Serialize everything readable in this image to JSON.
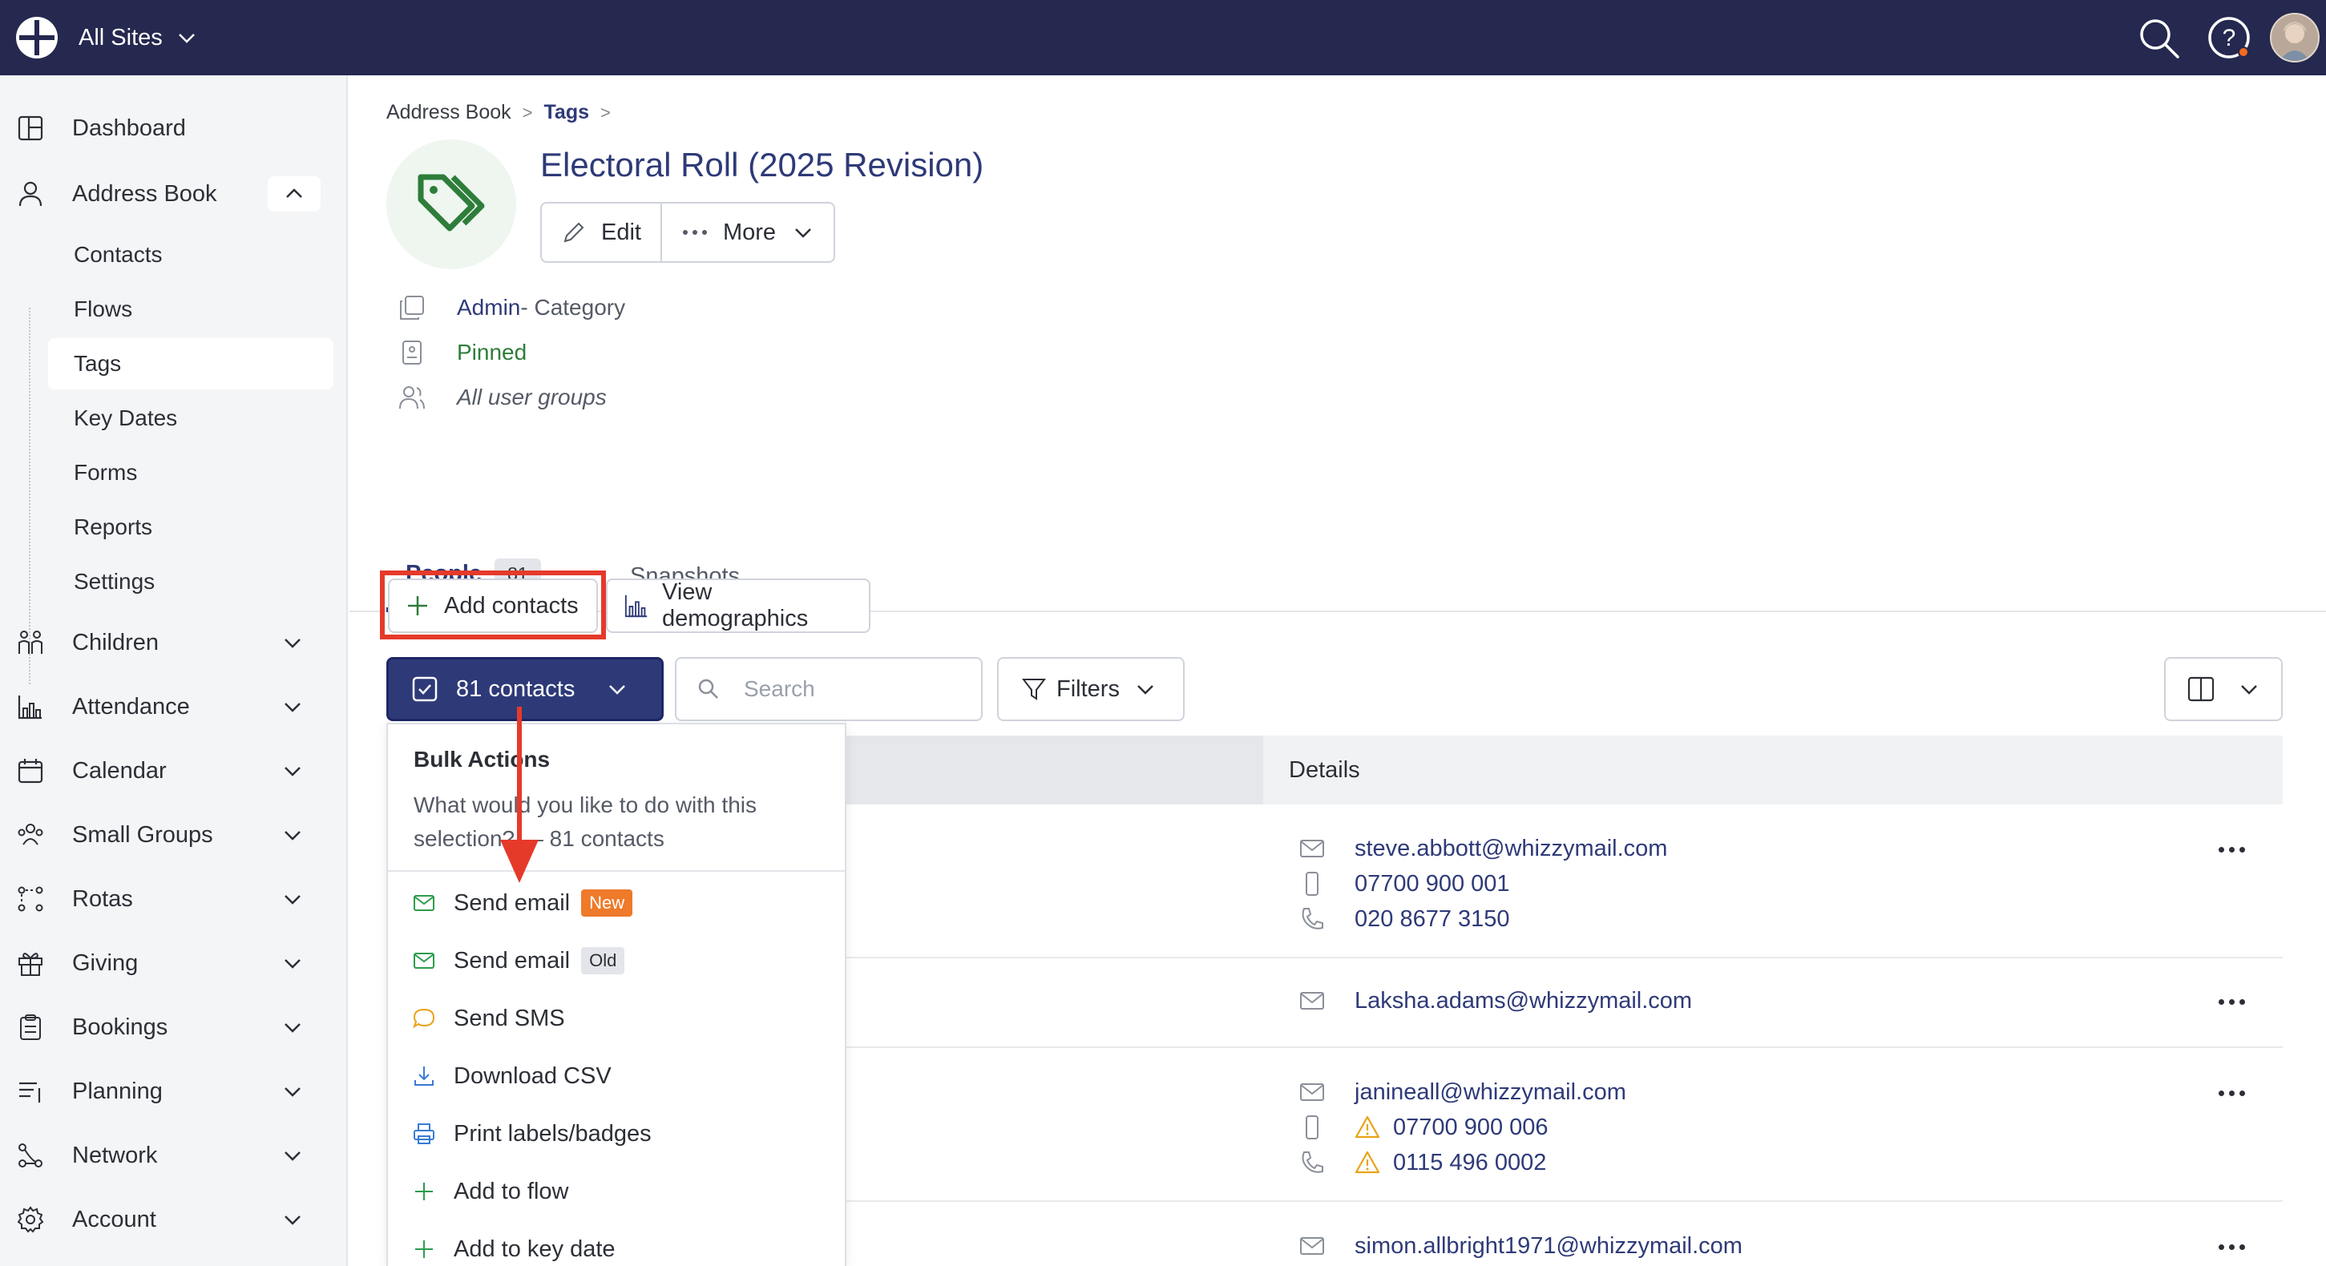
{
  "topbar": {
    "site_label": "All Sites"
  },
  "sidebar": {
    "items": [
      {
        "label": "Dashboard",
        "icon": "dashboard-icon"
      },
      {
        "label": "Address Book",
        "icon": "person-icon"
      },
      {
        "label": "Children",
        "icon": "children-icon"
      },
      {
        "label": "Attendance",
        "icon": "attendance-icon"
      },
      {
        "label": "Calendar",
        "icon": "calendar-icon"
      },
      {
        "label": "Small Groups",
        "icon": "small-groups-icon"
      },
      {
        "label": "Rotas",
        "icon": "rotas-icon"
      },
      {
        "label": "Giving",
        "icon": "gift-icon"
      },
      {
        "label": "Bookings",
        "icon": "bookings-icon"
      },
      {
        "label": "Planning",
        "icon": "planning-icon"
      },
      {
        "label": "Network",
        "icon": "network-icon"
      },
      {
        "label": "Account",
        "icon": "gear-icon"
      }
    ],
    "sub_items": [
      "Contacts",
      "Flows",
      "Tags",
      "Key Dates",
      "Forms",
      "Reports",
      "Settings"
    ],
    "active_sub": "Tags"
  },
  "breadcrumb": {
    "parent": "Address Book",
    "current": "Tags"
  },
  "tag": {
    "title": "Electoral Roll (2025 Revision)",
    "edit_label": "Edit",
    "more_label": "More",
    "category_link": "Admin",
    "category_suffix": " - Category",
    "pinned": "Pinned",
    "groups": "All user groups"
  },
  "tabs": {
    "people_label": "People",
    "people_count": "81",
    "snapshots_label": "Snapshots"
  },
  "toolbar": {
    "add_contacts": "Add contacts",
    "view_demographics": "View demographics",
    "selection_label": "81 contacts",
    "search_placeholder": "Search",
    "filters_label": "Filters"
  },
  "table": {
    "details_header": "Details",
    "rows": [
      {
        "email": "steve.abbott@whizzymail.com",
        "mobile": "07700 900 001",
        "phone": "020 8677 3150"
      },
      {
        "email": "Laksha.adams@whizzymail.com"
      },
      {
        "email": "janineall@whizzymail.com",
        "mobile": "07700 900 006",
        "phone": "0115 496 0002"
      },
      {
        "email": "simon.allbright1971@whizzymail.com"
      }
    ]
  },
  "bulk_actions": {
    "title": "Bulk Actions",
    "description": "What would you like to do with this selection? — 81 contacts",
    "items": [
      {
        "label": "Send email",
        "badge": "New"
      },
      {
        "label": "Send email",
        "badge": "Old"
      },
      {
        "label": "Send SMS"
      },
      {
        "label": "Download CSV"
      },
      {
        "label": "Print labels/badges"
      },
      {
        "label": "Add to flow"
      },
      {
        "label": "Add to key date"
      }
    ]
  },
  "colors": {
    "topbar": "#25284f",
    "primary": "#2e3a78",
    "highlight": "#e53a2a",
    "green": "#2e7d3a",
    "badge_new": "#ee7a2a"
  }
}
